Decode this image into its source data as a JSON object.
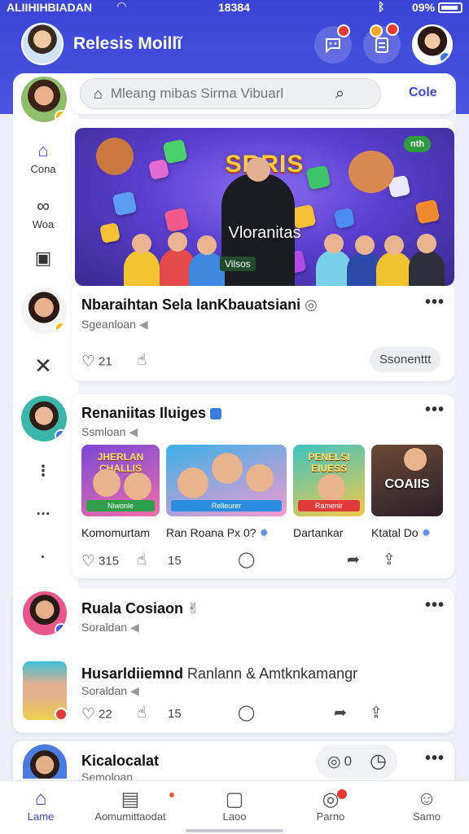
{
  "status_bar": {
    "carrier": "ALIIHIHBIADAN",
    "time": "18384",
    "battery_percent": "09%"
  },
  "header": {
    "title": "Relesis Moillĩ",
    "chat_badge": "",
    "compose_badge": ""
  },
  "search": {
    "placeholder": "Mleang mibas Sirma Vibuarl",
    "action_label": "Cole"
  },
  "sidebar": {
    "items": [
      {
        "label": "Cona",
        "icon": "home-icon"
      },
      {
        "label": "Woa",
        "icon": "link-icon"
      },
      {
        "label": "",
        "icon": "bookmark-icon"
      },
      {
        "label": "",
        "icon": "close-icon"
      }
    ]
  },
  "banner": {
    "title": "SRRIS",
    "subtitle": "Vloranitas",
    "tag": "Vilsos",
    "badge": "nth"
  },
  "posts": [
    {
      "title": "Nbaraihtan Sela lanKbauatsiani",
      "subtitle": "Sgeanloan",
      "likes": "21",
      "button": "Ssonenttt"
    },
    {
      "title": "Renaniitas Iluiges",
      "subtitle": "Ssmloan",
      "likes": "315",
      "shares": "15",
      "thumbnails": [
        {
          "label": "Komomurtam",
          "overlay": "JHERLAN CHALLIS",
          "band": "Niwonle"
        },
        {
          "label": "Ran Roana Px 0?",
          "overlay": "",
          "band": "Relleurer"
        },
        {
          "label": "Dartankar",
          "overlay": "PENELSI EIUESS",
          "band": "Ramenir"
        },
        {
          "label": "Ktatal Do",
          "overlay": "COAIIS",
          "band": ""
        }
      ]
    },
    {
      "title": "Ruala Cosiaon",
      "subtitle": "Soraldan"
    },
    {
      "title": "Husarldiiemnd",
      "title_extra": "Ranlann & Amtknkamangr",
      "subtitle": "Soraldan",
      "likes": "22",
      "shares": "15"
    },
    {
      "title": "Kicalocalat",
      "subtitle": "Semoloan",
      "count": "0"
    }
  ],
  "bottom_nav": [
    {
      "label": "Lame",
      "icon": "home-icon"
    },
    {
      "label": "Aomumittaodat",
      "icon": "gamepad-icon"
    },
    {
      "label": "Laoo",
      "icon": "music-icon"
    },
    {
      "label": "Parno",
      "icon": "trophy-icon"
    },
    {
      "label": "Samo",
      "icon": "person-icon"
    }
  ],
  "colors": {
    "primary": "#3a45d6",
    "badge_red": "#e53935",
    "online_yellow": "#f5b800",
    "background": "#eef0f7"
  }
}
